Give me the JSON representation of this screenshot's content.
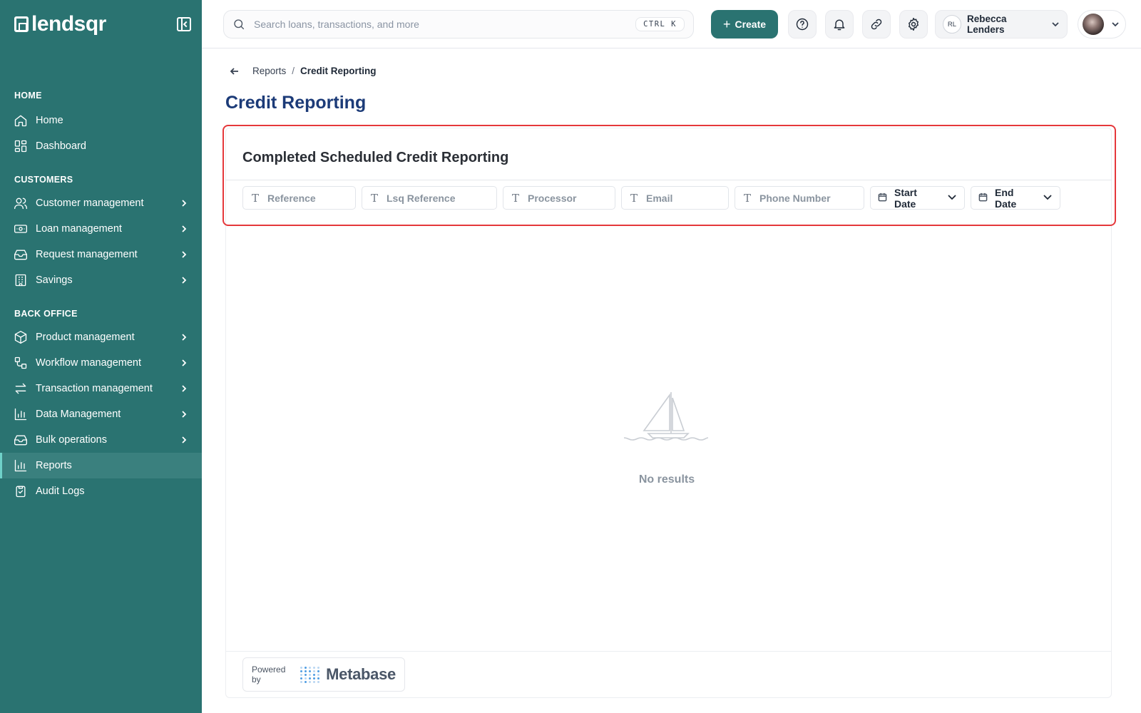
{
  "brand": {
    "name": "lendsqr"
  },
  "sidebar": {
    "sections": [
      {
        "label": "HOME"
      },
      {
        "label": "CUSTOMERS"
      },
      {
        "label": "BACK OFFICE"
      }
    ],
    "items": [
      {
        "label": "Home",
        "icon": "home-icon"
      },
      {
        "label": "Dashboard",
        "icon": "grid-icon"
      },
      {
        "label": "Customer management",
        "icon": "users-icon"
      },
      {
        "label": "Loan management",
        "icon": "banknote-icon"
      },
      {
        "label": "Request management",
        "icon": "inbox-icon"
      },
      {
        "label": "Savings",
        "icon": "building-icon"
      },
      {
        "label": "Product management",
        "icon": "box-icon"
      },
      {
        "label": "Workflow management",
        "icon": "workflow-icon"
      },
      {
        "label": "Transaction management",
        "icon": "arrows-icon"
      },
      {
        "label": "Data Management",
        "icon": "bar-chart-icon"
      },
      {
        "label": "Bulk operations",
        "icon": "inbox-icon"
      },
      {
        "label": "Reports",
        "icon": "bar-chart-icon"
      },
      {
        "label": "Audit Logs",
        "icon": "clipboard-icon"
      }
    ]
  },
  "topbar": {
    "search": {
      "placeholder": "Search loans, transactions, and more",
      "shortcut": "CTRL K"
    },
    "create_label": "Create",
    "user": {
      "initials": "RL",
      "name": "Rebecca Lenders"
    }
  },
  "breadcrumb": {
    "parent": "Reports",
    "separator": "/",
    "current": "Credit Reporting"
  },
  "page": {
    "title": "Credit Reporting"
  },
  "report": {
    "title": "Completed Scheduled Credit Reporting",
    "filters": [
      {
        "label": "Reference",
        "type": "text"
      },
      {
        "label": "Lsq Reference",
        "type": "text"
      },
      {
        "label": "Processor",
        "type": "text"
      },
      {
        "label": "Email",
        "type": "text"
      },
      {
        "label": "Phone Number",
        "type": "text"
      },
      {
        "label": "Start Date",
        "type": "date"
      },
      {
        "label": "End Date",
        "type": "date"
      }
    ],
    "empty_text": "No results",
    "powered_by": "Powered by",
    "powered_brand": "Metabase"
  },
  "colors": {
    "sidebar": "#2a7371",
    "accent": "#2a7371",
    "title": "#1c3b78",
    "highlight": "#e5383b"
  }
}
